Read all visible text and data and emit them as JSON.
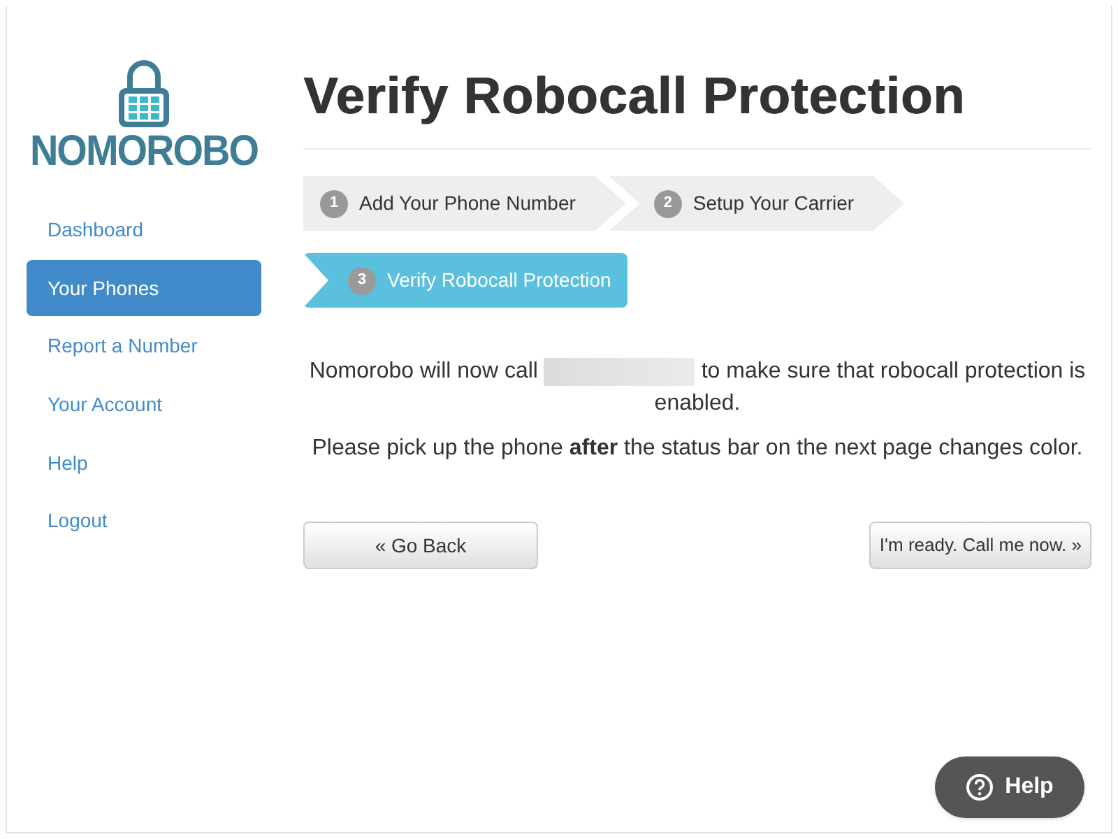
{
  "logo": {
    "text": "NOMOROBO"
  },
  "sidebar": {
    "items": [
      {
        "label": "Dashboard",
        "selected": false
      },
      {
        "label": "Your Phones",
        "selected": true
      },
      {
        "label": "Report a Number",
        "selected": false
      },
      {
        "label": "Your Account",
        "selected": false
      },
      {
        "label": "Help",
        "selected": false
      },
      {
        "label": "Logout",
        "selected": false
      }
    ]
  },
  "title": "Verify Robocall Protection",
  "steps": [
    {
      "number": "1",
      "label": "Add Your Phone Number",
      "selected": false
    },
    {
      "number": "2",
      "label": "Setup Your Carrier",
      "selected": false
    },
    {
      "number": "3",
      "label": "Verify Robocall Protection",
      "selected": true
    }
  ],
  "message": {
    "before": "Nomorobo will now call",
    "after": "to make sure that robocall protection is enabled."
  },
  "note": "Please pick up the phone **after** the status bar on the next page changes color.",
  "buttons": {
    "back": "« Go Back",
    "next": "I'm ready. Call me now. »"
  },
  "help_button": {
    "label": "Help"
  }
}
